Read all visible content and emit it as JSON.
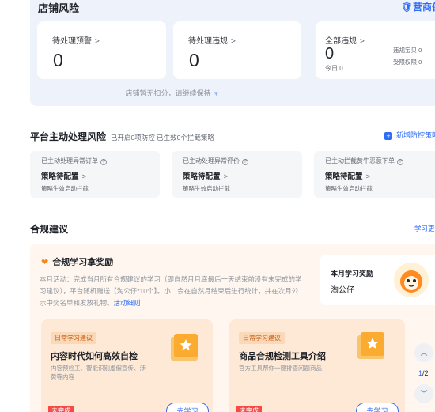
{
  "store_risk": {
    "title": "店铺风险",
    "logo": "营商保",
    "cards": [
      {
        "label": "待处理预警",
        "value": "0"
      },
      {
        "label": "待处理违规",
        "value": "0"
      },
      {
        "label": "全部违规",
        "value": "0",
        "today": "今日 0",
        "side": [
          {
            "label": "违规宝贝",
            "value": "0"
          },
          {
            "label": "受限权限",
            "value": "0"
          }
        ]
      }
    ],
    "footer": "店铺暂无扣分，请继续保持"
  },
  "platform": {
    "title": "平台主动处理风险",
    "subtitle": "已开启0项防控 已生效0个拦截策略",
    "add_label": "新增防控策略",
    "cards": [
      {
        "name": "已主动处理异常订单",
        "status": "策略待配置",
        "desc": "策略生效启动拦截"
      },
      {
        "name": "已主动处理异常评价",
        "status": "策略待配置",
        "desc": "策略生效启动拦截"
      },
      {
        "name": "已主动拦截黄牛恶意下单",
        "status": "策略待配置",
        "desc": "策略生效启动拦截"
      }
    ]
  },
  "compliance": {
    "title": "合规建议",
    "link": "学习更多",
    "reward_title": "合规学习拿奖励",
    "reward_desc": "本月活动：完成当月所有合规建议的学习（即自然月月底最后一天结束前没有未完成的学习建议），平台随机赠送【淘公仔*10个】。小二会在自然月结束后进行统计，并在次月公示中奖名单和发放礼物。",
    "reward_link": "活动细则",
    "prize_label": "本月学习奖励",
    "prize_value": "淘公仔",
    "lessons": [
      {
        "tag": "日常学习建议",
        "title": "内容时代如何高效自检",
        "desc": "内容预检工、智能识别虚假宣传、涉黄等内容",
        "state": "未完成",
        "button": "去学习"
      },
      {
        "tag": "日常学习建议",
        "title": "商品合规检测工具介绍",
        "desc": "官方工具帮你一键排查问题商品",
        "state": "未完成",
        "button": "去学习"
      }
    ],
    "pager": {
      "current": "1",
      "total": "/2"
    }
  },
  "colors": {
    "accent": "#2d6cf6",
    "warning": "#f54a45",
    "orange": "#f5871f"
  }
}
